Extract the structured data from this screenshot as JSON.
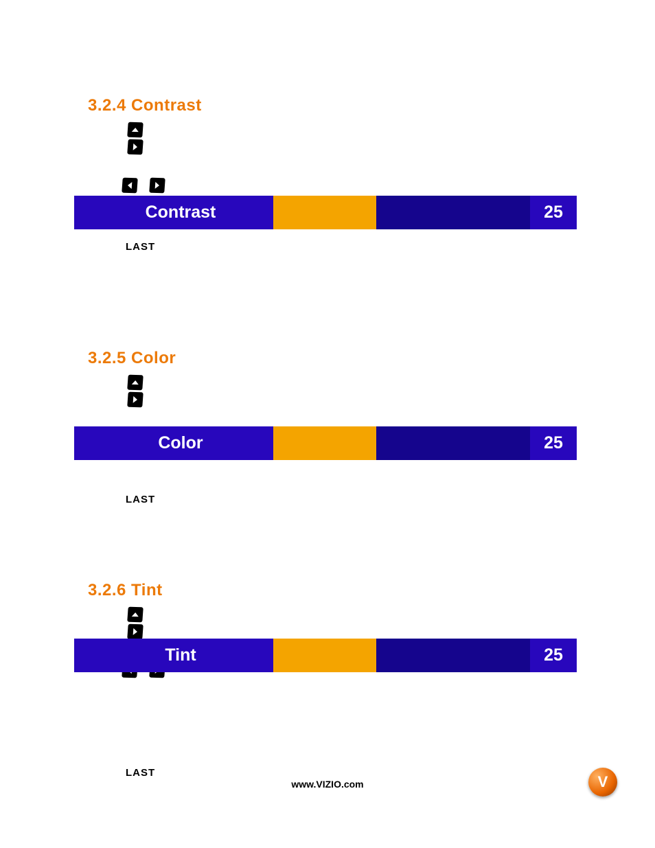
{
  "sections": [
    {
      "heading": "3.2.4 Contrast",
      "slider_label": "Contrast",
      "slider_value": "25",
      "last": "LAST"
    },
    {
      "heading": "3.2.5 Color",
      "slider_label": "Color",
      "slider_value": "25",
      "last": "LAST"
    },
    {
      "heading": "3.2.6 Tint",
      "slider_label": "Tint",
      "slider_value": "25",
      "last": "LAST"
    }
  ],
  "footer": "www.VIZIO.com",
  "logo_letter": "V"
}
